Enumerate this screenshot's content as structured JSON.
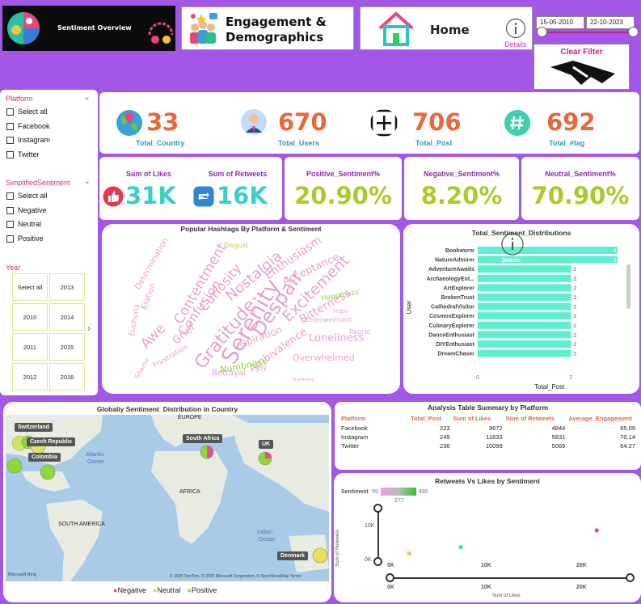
{
  "header": {
    "banner_title": "Sentiment Overview",
    "engagement_title_line1": "Engagement &",
    "engagement_title_line2": "Demographics",
    "home_title": "Home",
    "home_details": "Details",
    "date_start": "15-05-2010",
    "date_end": "22-10-2023",
    "clear_filter": "Clear Filter"
  },
  "filters": {
    "platform_title": "Platform",
    "platform_options": [
      "Select all",
      "Facebook",
      "Instagram",
      "Twitter"
    ],
    "sentiment_title": "SimplifiedSentiment",
    "sentiment_options": [
      "Select all",
      "Negative",
      "Neutral",
      "Positive"
    ],
    "year_title": "Year",
    "year_tiles": [
      "Select all",
      "2013",
      "2010",
      "2014",
      "2011",
      "2015",
      "2012",
      "2016"
    ]
  },
  "kpis": {
    "country_value": "33",
    "country_label": "Total_Country",
    "users_value": "670",
    "users_label": "Total_Users",
    "post_value": "706",
    "post_label": "Total_Post",
    "tag_value": "692",
    "tag_label": "Total_#tag"
  },
  "metrics": {
    "likes_label": "Sum of Likes",
    "likes_value": "31K",
    "retweets_label": "Sum of Retweets",
    "retweets_value": "16K",
    "positive_label": "Positive_Sentiment%",
    "positive_value": "20.90%",
    "negative_label": "Negative_Sentiment%",
    "negative_value": "8.20%",
    "neutral_label": "Neutral_Sentiment%",
    "neutral_value": "70.90%"
  },
  "wordcloud": {
    "title": "Popular Hashtags By Platform & Sentiment",
    "words": [
      "Serenity",
      "Despair",
      "Gratitude",
      "Nostalgia",
      "Excitement",
      "Contentment",
      "Curiosity",
      "Confusion",
      "Enthusiasm",
      "Acceptance",
      "Awe",
      "Grief",
      "Bitterness",
      "Loneliness",
      "Ambivalence",
      "Empowerment",
      "Inspiration",
      "Numbness",
      "Betrayal",
      "Overwhelmed",
      "Happiness",
      "Determination",
      "Elation",
      "Joy",
      "Hope",
      "Euphoria",
      "Regret",
      "Frustration",
      "Disgust",
      "Harmony",
      "Shame"
    ]
  },
  "sentiment_dist": {
    "title": "Total_Sentiment_Distributions",
    "ylabel": "User",
    "xlabel": "Total_Post",
    "details_label": "Details",
    "users": [
      "Bookworm",
      "NatureAdmirer",
      "AdventureAwaits",
      "ArchaeologyEnt...",
      "ArtExplorer",
      "BrokenTrust",
      "CathedralVisitor",
      "CosmosExplorer",
      "CulinaryExplorer",
      "DanceEnthusiast",
      "DIYEnthusiast",
      "DreamChaser"
    ],
    "values": [
      3,
      3,
      2,
      2,
      2,
      2,
      2,
      2,
      2,
      2,
      2,
      2
    ],
    "x_ticks": [
      "0",
      "2"
    ]
  },
  "map": {
    "title": "Globaliy Sentiment_Distribution in Country",
    "labels": [
      "Switzerland",
      "Czech Republic",
      "Colombia",
      "South Africa",
      "UK",
      "Denmark"
    ],
    "regions": [
      "EUROPE",
      "Atlantic",
      "Ocean",
      "AFRICA",
      "SOUTH AMERICA",
      "Indian",
      "Ocean"
    ],
    "attribution": "© 2025 TomTom, © 2025 Microsoft Corporation, © OpenStreetMap  Terms",
    "bing": "Microsoft Bing",
    "legend": [
      "Negative",
      "Neutral",
      "Positive"
    ],
    "legend_colors": [
      "#e84d8a",
      "#e8d83a",
      "#8ed83a"
    ]
  },
  "summary_table": {
    "title": "Analysis Table Summary by Platform",
    "headers": [
      "Platform",
      "Total_Post",
      "Sum of Likes",
      "Sum of Retweets",
      "Average_Engagement"
    ],
    "rows": [
      [
        "Facebook",
        "223",
        "9672",
        "4844",
        "65.09"
      ],
      [
        "Instagram",
        "249",
        "11633",
        "5831",
        "70.14"
      ],
      [
        "Twitter",
        "236",
        "10099",
        "5069",
        "64.27"
      ]
    ]
  },
  "scatter": {
    "title": "Retweets Vs Likes by Sentiment",
    "legend_label": "Sentiment",
    "gradient_min": "59",
    "gradient_mid": "277",
    "gradient_max": "495",
    "ylabel": "Sum of Retweets",
    "xlabel": "Sum of Likes",
    "y_ticks": [
      "10K",
      "0K"
    ],
    "x_ticks": [
      "0K",
      "10K",
      "20K"
    ],
    "x_ticks_bottom": [
      "0K",
      "10K",
      "20K"
    ]
  },
  "chart_data": [
    {
      "type": "bar",
      "title": "Total_Sentiment_Distributions",
      "xlabel": "Total_Post",
      "ylabel": "User",
      "categories": [
        "Bookworm",
        "NatureAdmirer",
        "AdventureAwaits",
        "ArchaeologyEnt...",
        "ArtExplorer",
        "BrokenTrust",
        "CathedralVisitor",
        "CosmosExplorer",
        "CulinaryExplorer",
        "DanceEnthusiast",
        "DIYEnthusiast",
        "DreamChaser"
      ],
      "values": [
        3,
        3,
        2,
        2,
        2,
        2,
        2,
        2,
        2,
        2,
        2,
        2
      ],
      "xlim": [
        0,
        3
      ]
    },
    {
      "type": "scatter",
      "title": "Retweets Vs Likes by Sentiment",
      "xlabel": "Sum of Likes",
      "ylabel": "Sum of Retweets",
      "points": [
        {
          "x": 2000,
          "y": 500,
          "color": "#f0c23a"
        },
        {
          "x": 7500,
          "y": 2000,
          "color": "#3ad6c6"
        },
        {
          "x": 22000,
          "y": 6000,
          "color": "#e040c8"
        }
      ],
      "xlim": [
        0,
        25000
      ],
      "ylim": [
        0,
        12000
      ]
    }
  ]
}
